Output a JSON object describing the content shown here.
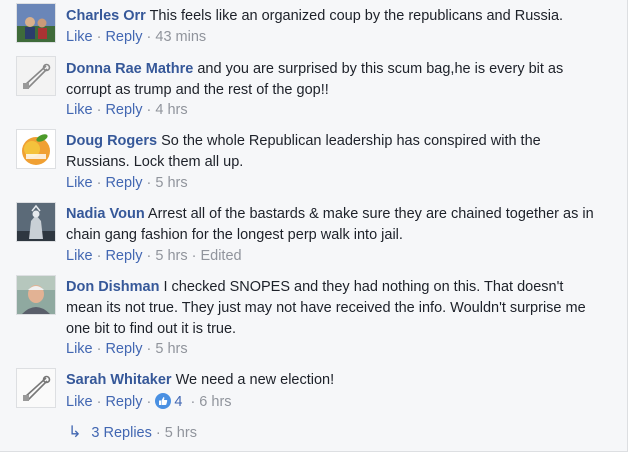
{
  "labels": {
    "like": "Like",
    "reply": "Reply"
  },
  "comments": [
    {
      "name": "Charles Orr",
      "text": "This feels like an organized coup by the republicans and Russia.",
      "time": "43 mins",
      "edited": "",
      "avatar": "photo-avatar"
    },
    {
      "name": "Donna Rae Mathre",
      "text": "and you are surprised by this scum bag,he is every bit as corrupt as trump and the rest of the gop!!",
      "time": "4 hrs",
      "edited": "",
      "avatar": "safety-pin-avatar"
    },
    {
      "name": "Doug Rogers",
      "text": "So the whole Republican leadership has conspired with the Russians. Lock them all up.",
      "time": "5 hrs",
      "edited": "",
      "avatar": "peach-avatar"
    },
    {
      "name": "Nadia Voun",
      "text": "Arrest all of the bastards & make sure they are chained together as in chain gang fashion for the longest perp walk into jail.",
      "time": "5 hrs",
      "edited": "Edited",
      "avatar": "statue-avatar"
    },
    {
      "name": "Don Dishman",
      "text": "I checked SNOPES and they had nothing on this. That doesn't mean its not true. They just may not have received the info. Wouldn't surprise me one bit to find out it is true.",
      "time": "5 hrs",
      "edited": "",
      "avatar": "man-photo-avatar"
    },
    {
      "name": "Sarah Whitaker",
      "text": "We need a new election!",
      "time": "6 hrs",
      "edited": "",
      "avatar": "safety-pin-avatar",
      "reactions": "4"
    }
  ],
  "replies": {
    "label": "3 Replies",
    "time": "5 hrs"
  },
  "colors": {
    "name": "#365899",
    "link": "#4267b2",
    "meta": "#90949c",
    "like_badge": "#4a90e2"
  }
}
